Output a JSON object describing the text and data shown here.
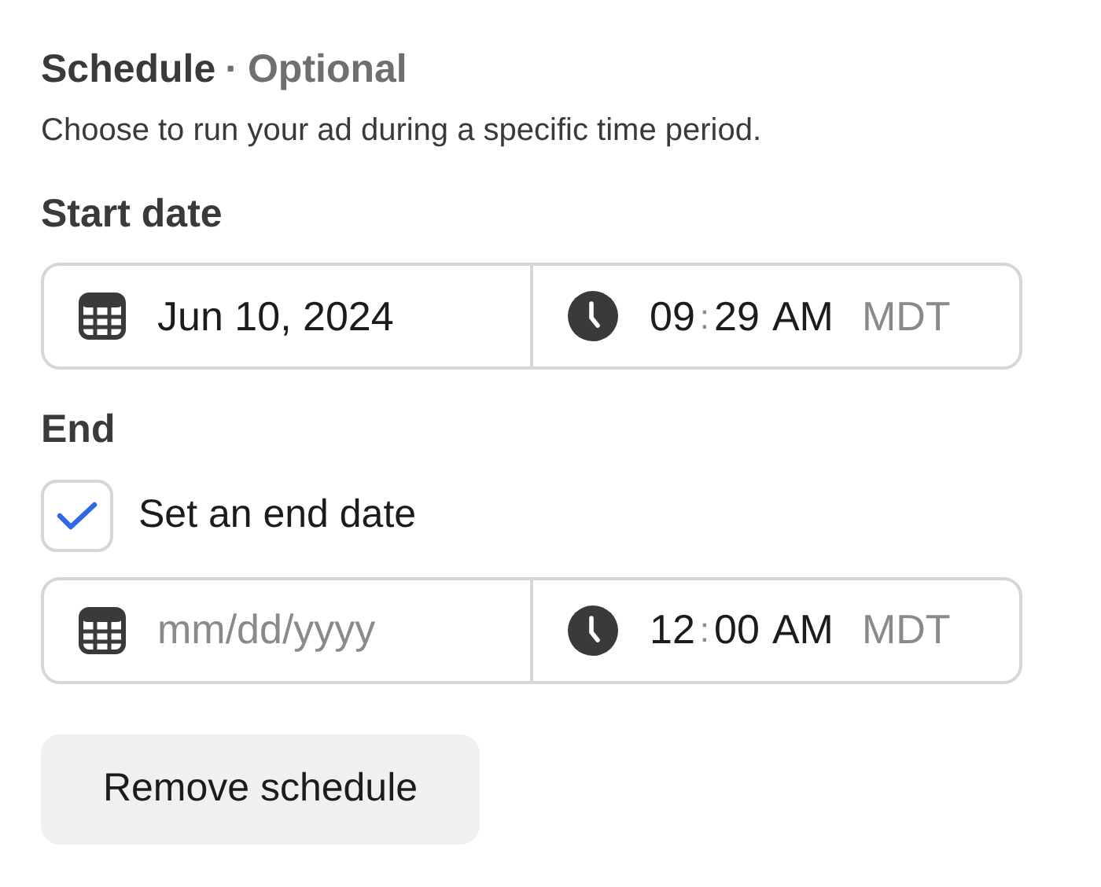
{
  "section": {
    "title": "Schedule",
    "separator": "·",
    "optional": "Optional",
    "description": "Choose to run your ad during a specific time period."
  },
  "start": {
    "label": "Start date",
    "date": {
      "value": "Jun 10, 2024"
    },
    "time": {
      "hour": "09",
      "separator": ":",
      "minute": "29",
      "period": "AM",
      "zone": "MDT"
    }
  },
  "end": {
    "label": "End",
    "checkbox": {
      "label": "Set an end date",
      "checked": true
    },
    "date": {
      "placeholder": "mm/dd/yyyy"
    },
    "time": {
      "hour": "12",
      "separator": ":",
      "minute": "00",
      "period": "AM",
      "zone": "MDT"
    }
  },
  "button": {
    "label": "Remove schedule"
  }
}
